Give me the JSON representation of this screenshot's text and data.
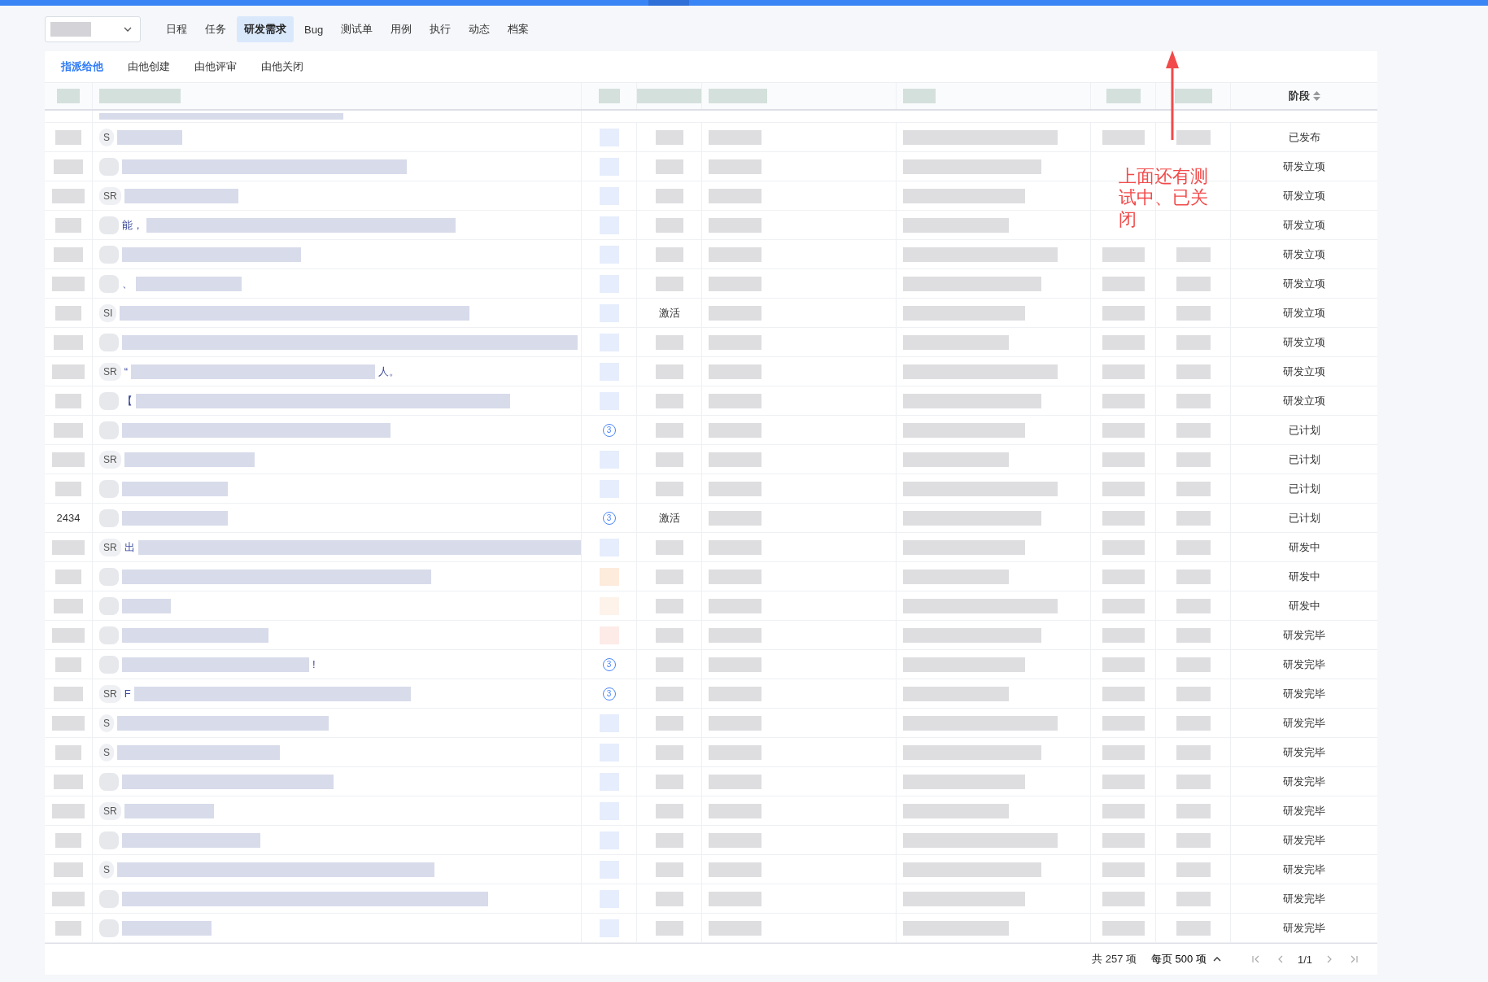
{
  "nav": {
    "tabs": [
      {
        "label": "日程",
        "selected": false
      },
      {
        "label": "任务",
        "selected": false
      },
      {
        "label": "研发需求",
        "selected": true
      },
      {
        "label": "Bug",
        "selected": false
      },
      {
        "label": "测试单",
        "selected": false
      },
      {
        "label": "用例",
        "selected": false
      },
      {
        "label": "执行",
        "selected": false
      },
      {
        "label": "动态",
        "selected": false
      },
      {
        "label": "档案",
        "selected": false
      }
    ]
  },
  "sub_tabs": [
    {
      "label": "指派给他",
      "selected": true
    },
    {
      "label": "由他创建",
      "selected": false
    },
    {
      "label": "由他评审",
      "selected": false
    },
    {
      "label": "由他关闭",
      "selected": false
    }
  ],
  "table": {
    "stage_column": {
      "label": "阶段"
    },
    "rows": [
      {
        "badge": "S",
        "priority": {
          "kind": "dot",
          "color": "#e6edfc"
        },
        "stage": "已发布"
      },
      {
        "priority": {
          "kind": "dot",
          "color": "#e6edfc"
        },
        "stage": "研发立项"
      },
      {
        "badge": "SR",
        "priority": {
          "kind": "dot",
          "color": "#e6edfc"
        },
        "stage": "研发立项"
      },
      {
        "title_fragment": "能，",
        "priority": {
          "kind": "dot",
          "color": "#e6edfc"
        },
        "stage": "研发立项"
      },
      {
        "priority": {
          "kind": "dot",
          "color": "#e6edfc"
        },
        "stage": "研发立项"
      },
      {
        "title_fragment": "、",
        "priority": {
          "kind": "dot",
          "color": "#e6edfc"
        },
        "stage": "研发立项"
      },
      {
        "badge": "SI",
        "priority": {
          "kind": "dot",
          "color": "#e6edfc"
        },
        "status": "激活",
        "stage": "研发立项"
      },
      {
        "priority": {
          "kind": "dot",
          "color": "#e6edfc"
        },
        "stage": "研发立项"
      },
      {
        "badge": "SR",
        "title_fragment": "“",
        "title_end": "人。",
        "priority": {
          "kind": "dot",
          "color": "#e6edfc"
        },
        "stage": "研发立项"
      },
      {
        "title_fragment": "【",
        "priority": {
          "kind": "dot",
          "color": "#e6edfc"
        },
        "stage": "研发立项"
      },
      {
        "priority": {
          "kind": "number",
          "text": "3"
        },
        "stage": "已计划"
      },
      {
        "badge": "SR",
        "priority": {
          "kind": "dot",
          "color": "#e6edfc"
        },
        "stage": "已计划"
      },
      {
        "priority": {
          "kind": "dot",
          "color": "#e6edfc"
        },
        "stage": "已计划"
      },
      {
        "id": "2434",
        "priority": {
          "kind": "number",
          "text": "3"
        },
        "status": "激活",
        "stage": "已计划"
      },
      {
        "badge": "SR",
        "title_fragment": "出",
        "priority": {
          "kind": "dot",
          "color": "#e6edfc"
        },
        "stage": "研发中"
      },
      {
        "priority": {
          "kind": "dot",
          "color": "#fdebdc"
        },
        "stage": "研发中"
      },
      {
        "priority": {
          "kind": "dot",
          "color": "#fdf3ea"
        },
        "stage": "研发中"
      },
      {
        "priority": {
          "kind": "dot",
          "color": "#fdebe8"
        },
        "stage": "研发完毕"
      },
      {
        "title_end": "!",
        "priority": {
          "kind": "number",
          "text": "3"
        },
        "stage": "研发完毕"
      },
      {
        "badge": "SR",
        "title_fragment": "F",
        "priority": {
          "kind": "number",
          "text": "3"
        },
        "stage": "研发完毕"
      },
      {
        "badge": "S",
        "priority": {
          "kind": "dot",
          "color": "#e6edfc"
        },
        "stage": "研发完毕"
      },
      {
        "badge": "S",
        "priority": {
          "kind": "dot",
          "color": "#e6edfc"
        },
        "stage": "研发完毕"
      },
      {
        "priority": {
          "kind": "dot",
          "color": "#e6edfc"
        },
        "stage": "研发完毕"
      },
      {
        "badge": "SR",
        "priority": {
          "kind": "dot",
          "color": "#e6edfc"
        },
        "stage": "研发完毕"
      },
      {
        "priority": {
          "kind": "dot",
          "color": "#e6edfc"
        },
        "stage": "研发完毕"
      },
      {
        "badge": "S",
        "priority": {
          "kind": "dot",
          "color": "#e6edfc"
        },
        "stage": "研发完毕"
      },
      {
        "priority": {
          "kind": "dot",
          "color": "#e6edfc"
        },
        "stage": "研发完毕"
      },
      {
        "priority": {
          "kind": "dot",
          "color": "#e6edfc"
        },
        "stage": "研发完毕"
      }
    ]
  },
  "pager": {
    "total": "共 257 项",
    "page_size": "每页 500 项",
    "page": "1/1"
  },
  "annotation": {
    "text": "上面还有测试中、已关闭"
  }
}
